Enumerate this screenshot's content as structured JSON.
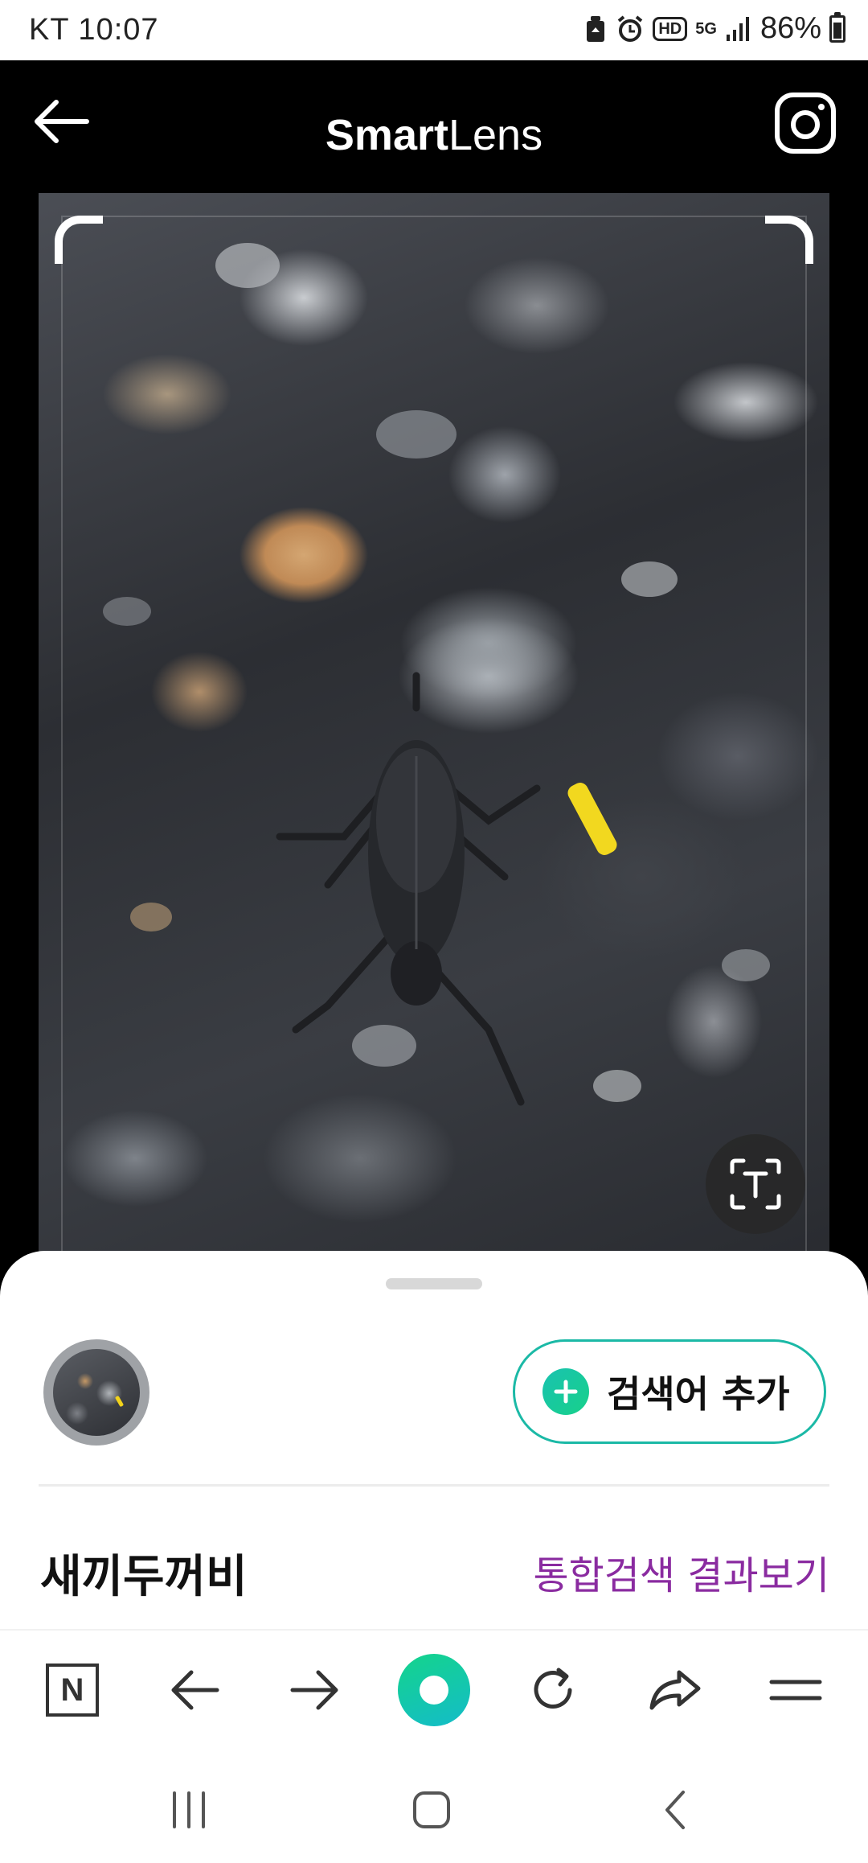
{
  "status_bar": {
    "carrier_time": "KT 10:07",
    "hd_label": "HD",
    "network_label": "5G",
    "battery": "86%"
  },
  "header": {
    "title_bold": "Smart",
    "title_light": "Lens"
  },
  "sheet": {
    "add_keyword_label": "검색어 추가",
    "result_name": "새끼두꺼비",
    "integrated_search_link": "통합검색 결과보기"
  },
  "toolbar": {
    "naver_home_label": "N"
  },
  "colors": {
    "accent_green": "#1bb9a6",
    "link_purple": "#8a2ba0"
  }
}
